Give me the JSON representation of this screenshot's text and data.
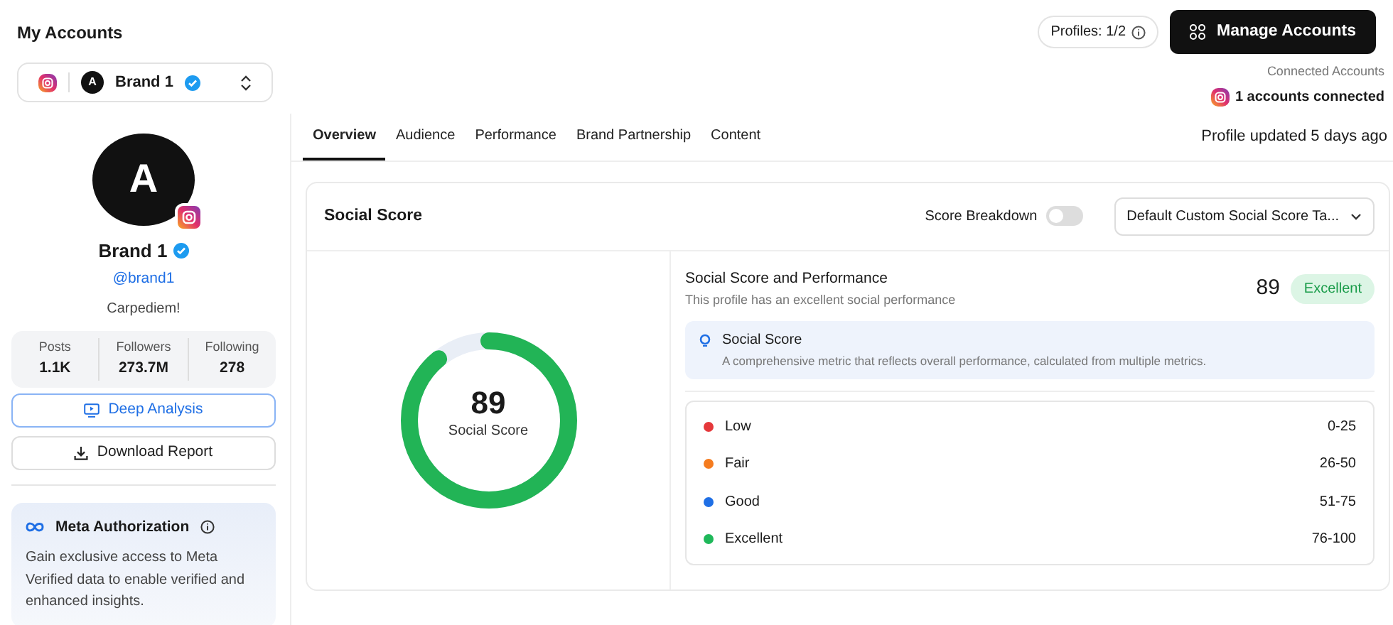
{
  "header": {
    "title": "My Accounts",
    "profiles": "Profiles: 1/2",
    "manage_button": "Manage Accounts"
  },
  "account_selector": {
    "avatar_letter": "A",
    "name": "Brand 1",
    "verified": true
  },
  "connected": {
    "label": "Connected Accounts",
    "text": "1 accounts connected"
  },
  "profile": {
    "avatar_letter": "A",
    "name": "Brand 1",
    "verified": true,
    "handle": "@brand1",
    "bio": "Carpediem!",
    "stats": [
      {
        "label": "Posts",
        "value": "1.1K"
      },
      {
        "label": "Followers",
        "value": "273.7M"
      },
      {
        "label": "Following",
        "value": "278"
      }
    ],
    "buttons": [
      {
        "kind": "primary",
        "label": "Deep Analysis"
      },
      {
        "kind": "download",
        "label": "Download Report"
      }
    ],
    "meta": {
      "title": "Meta Authorization",
      "text": "Gain exclusive access to Meta Verified data to enable verified and enhanced insights."
    }
  },
  "tabs": [
    {
      "label": "Overview",
      "selected": true
    },
    {
      "label": "Audience",
      "selected": false
    },
    {
      "label": "Performance",
      "selected": false
    },
    {
      "label": "Brand Partnership",
      "selected": false
    },
    {
      "label": "Content",
      "selected": false
    }
  ],
  "updated": "Profile updated 5 days ago",
  "card": {
    "title": "Social Score",
    "toggle_label": "Score Breakdown",
    "toggle_on": false,
    "dropdown": "Default Custom Social Score Ta...",
    "gauge": {
      "value": "89",
      "label": "Social Score",
      "level": 0.89
    },
    "summary": {
      "title": "Social Score and Performance",
      "subtitle": "This profile has an excellent social performance",
      "score": "89",
      "badge": "Excellent"
    },
    "info": {
      "title": "Social Score",
      "text": "A comprehensive metric that reflects overall performance, calculated from multiple metrics."
    },
    "ranges": [
      {
        "label": "Low",
        "range": "0-25",
        "color": "#e5383b"
      },
      {
        "label": "Fair",
        "range": "26-50",
        "color": "#f57c1f"
      },
      {
        "label": "Good",
        "range": "51-75",
        "color": "#1f6fe5"
      },
      {
        "label": "Excellent",
        "range": "76-100",
        "color": "#1fb85a"
      }
    ]
  }
}
